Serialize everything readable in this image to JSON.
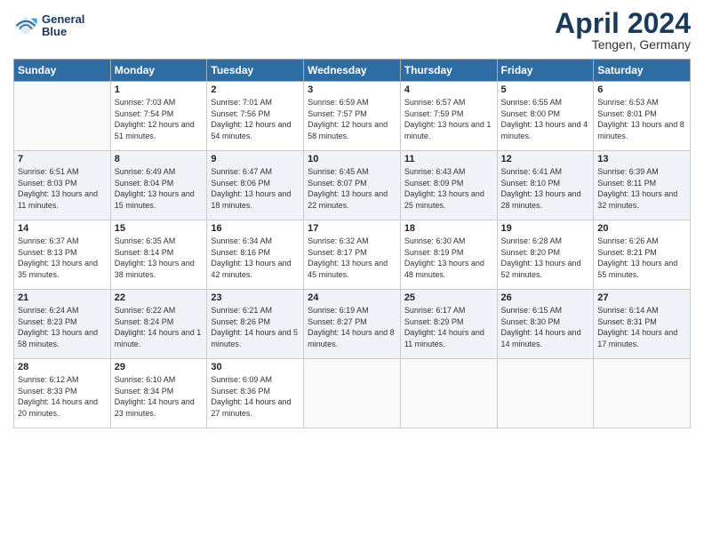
{
  "logo": {
    "line1": "General",
    "line2": "Blue"
  },
  "title": "April 2024",
  "location": "Tengen, Germany",
  "days_of_week": [
    "Sunday",
    "Monday",
    "Tuesday",
    "Wednesday",
    "Thursday",
    "Friday",
    "Saturday"
  ],
  "weeks": [
    [
      {
        "day": "",
        "sunrise": "",
        "sunset": "",
        "daylight": ""
      },
      {
        "day": "1",
        "sunrise": "Sunrise: 7:03 AM",
        "sunset": "Sunset: 7:54 PM",
        "daylight": "Daylight: 12 hours and 51 minutes."
      },
      {
        "day": "2",
        "sunrise": "Sunrise: 7:01 AM",
        "sunset": "Sunset: 7:56 PM",
        "daylight": "Daylight: 12 hours and 54 minutes."
      },
      {
        "day": "3",
        "sunrise": "Sunrise: 6:59 AM",
        "sunset": "Sunset: 7:57 PM",
        "daylight": "Daylight: 12 hours and 58 minutes."
      },
      {
        "day": "4",
        "sunrise": "Sunrise: 6:57 AM",
        "sunset": "Sunset: 7:59 PM",
        "daylight": "Daylight: 13 hours and 1 minute."
      },
      {
        "day": "5",
        "sunrise": "Sunrise: 6:55 AM",
        "sunset": "Sunset: 8:00 PM",
        "daylight": "Daylight: 13 hours and 4 minutes."
      },
      {
        "day": "6",
        "sunrise": "Sunrise: 6:53 AM",
        "sunset": "Sunset: 8:01 PM",
        "daylight": "Daylight: 13 hours and 8 minutes."
      }
    ],
    [
      {
        "day": "7",
        "sunrise": "Sunrise: 6:51 AM",
        "sunset": "Sunset: 8:03 PM",
        "daylight": "Daylight: 13 hours and 11 minutes."
      },
      {
        "day": "8",
        "sunrise": "Sunrise: 6:49 AM",
        "sunset": "Sunset: 8:04 PM",
        "daylight": "Daylight: 13 hours and 15 minutes."
      },
      {
        "day": "9",
        "sunrise": "Sunrise: 6:47 AM",
        "sunset": "Sunset: 8:06 PM",
        "daylight": "Daylight: 13 hours and 18 minutes."
      },
      {
        "day": "10",
        "sunrise": "Sunrise: 6:45 AM",
        "sunset": "Sunset: 8:07 PM",
        "daylight": "Daylight: 13 hours and 22 minutes."
      },
      {
        "day": "11",
        "sunrise": "Sunrise: 6:43 AM",
        "sunset": "Sunset: 8:09 PM",
        "daylight": "Daylight: 13 hours and 25 minutes."
      },
      {
        "day": "12",
        "sunrise": "Sunrise: 6:41 AM",
        "sunset": "Sunset: 8:10 PM",
        "daylight": "Daylight: 13 hours and 28 minutes."
      },
      {
        "day": "13",
        "sunrise": "Sunrise: 6:39 AM",
        "sunset": "Sunset: 8:11 PM",
        "daylight": "Daylight: 13 hours and 32 minutes."
      }
    ],
    [
      {
        "day": "14",
        "sunrise": "Sunrise: 6:37 AM",
        "sunset": "Sunset: 8:13 PM",
        "daylight": "Daylight: 13 hours and 35 minutes."
      },
      {
        "day": "15",
        "sunrise": "Sunrise: 6:35 AM",
        "sunset": "Sunset: 8:14 PM",
        "daylight": "Daylight: 13 hours and 38 minutes."
      },
      {
        "day": "16",
        "sunrise": "Sunrise: 6:34 AM",
        "sunset": "Sunset: 8:16 PM",
        "daylight": "Daylight: 13 hours and 42 minutes."
      },
      {
        "day": "17",
        "sunrise": "Sunrise: 6:32 AM",
        "sunset": "Sunset: 8:17 PM",
        "daylight": "Daylight: 13 hours and 45 minutes."
      },
      {
        "day": "18",
        "sunrise": "Sunrise: 6:30 AM",
        "sunset": "Sunset: 8:19 PM",
        "daylight": "Daylight: 13 hours and 48 minutes."
      },
      {
        "day": "19",
        "sunrise": "Sunrise: 6:28 AM",
        "sunset": "Sunset: 8:20 PM",
        "daylight": "Daylight: 13 hours and 52 minutes."
      },
      {
        "day": "20",
        "sunrise": "Sunrise: 6:26 AM",
        "sunset": "Sunset: 8:21 PM",
        "daylight": "Daylight: 13 hours and 55 minutes."
      }
    ],
    [
      {
        "day": "21",
        "sunrise": "Sunrise: 6:24 AM",
        "sunset": "Sunset: 8:23 PM",
        "daylight": "Daylight: 13 hours and 58 minutes."
      },
      {
        "day": "22",
        "sunrise": "Sunrise: 6:22 AM",
        "sunset": "Sunset: 8:24 PM",
        "daylight": "Daylight: 14 hours and 1 minute."
      },
      {
        "day": "23",
        "sunrise": "Sunrise: 6:21 AM",
        "sunset": "Sunset: 8:26 PM",
        "daylight": "Daylight: 14 hours and 5 minutes."
      },
      {
        "day": "24",
        "sunrise": "Sunrise: 6:19 AM",
        "sunset": "Sunset: 8:27 PM",
        "daylight": "Daylight: 14 hours and 8 minutes."
      },
      {
        "day": "25",
        "sunrise": "Sunrise: 6:17 AM",
        "sunset": "Sunset: 8:29 PM",
        "daylight": "Daylight: 14 hours and 11 minutes."
      },
      {
        "day": "26",
        "sunrise": "Sunrise: 6:15 AM",
        "sunset": "Sunset: 8:30 PM",
        "daylight": "Daylight: 14 hours and 14 minutes."
      },
      {
        "day": "27",
        "sunrise": "Sunrise: 6:14 AM",
        "sunset": "Sunset: 8:31 PM",
        "daylight": "Daylight: 14 hours and 17 minutes."
      }
    ],
    [
      {
        "day": "28",
        "sunrise": "Sunrise: 6:12 AM",
        "sunset": "Sunset: 8:33 PM",
        "daylight": "Daylight: 14 hours and 20 minutes."
      },
      {
        "day": "29",
        "sunrise": "Sunrise: 6:10 AM",
        "sunset": "Sunset: 8:34 PM",
        "daylight": "Daylight: 14 hours and 23 minutes."
      },
      {
        "day": "30",
        "sunrise": "Sunrise: 6:09 AM",
        "sunset": "Sunset: 8:36 PM",
        "daylight": "Daylight: 14 hours and 27 minutes."
      },
      {
        "day": "",
        "sunrise": "",
        "sunset": "",
        "daylight": ""
      },
      {
        "day": "",
        "sunrise": "",
        "sunset": "",
        "daylight": ""
      },
      {
        "day": "",
        "sunrise": "",
        "sunset": "",
        "daylight": ""
      },
      {
        "day": "",
        "sunrise": "",
        "sunset": "",
        "daylight": ""
      }
    ]
  ]
}
